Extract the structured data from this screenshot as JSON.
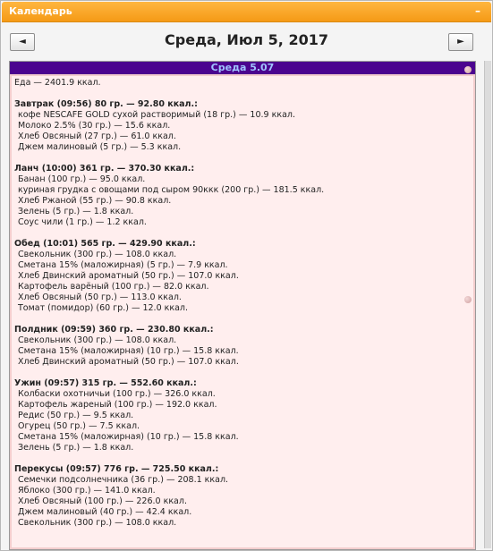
{
  "window": {
    "title": "Календарь",
    "minimize_icon": "minimize-icon"
  },
  "nav": {
    "prev_label": "◄",
    "next_label": "►",
    "date_title": "Среда, Июл 5, 2017"
  },
  "day": {
    "header": "Среда 5.07",
    "total": "Еда — 2401.9 ккал.",
    "meals": [
      {
        "header": "Завтрак (09:56) 80 гр. — 92.80 ккал.:",
        "items": [
          "кофе NESCAFE GOLD сухой растворимый (18 гр.) — 10.9 ккал.",
          "Молоко 2.5% (30 гр.) — 15.6 ккал.",
          "Хлеб Овсяный (27 гр.) — 61.0 ккал.",
          "Джем малиновый (5 гр.) — 5.3 ккал."
        ]
      },
      {
        "header": "Ланч (10:00) 361 гр. — 370.30 ккал.:",
        "items": [
          "Банан (100 гр.) — 95.0 ккал.",
          "куриная грудка с овощами под сыром 90ккк (200 гр.) — 181.5 ккал.",
          "Хлеб Ржаной (55 гр.) — 90.8 ккал.",
          "Зелень (5 гр.) — 1.8 ккал.",
          "Соус чили (1 гр.) — 1.2 ккал."
        ]
      },
      {
        "header": "Обед (10:01) 565 гр. — 429.90 ккал.:",
        "items": [
          "Свекольник (300 гр.) — 108.0 ккал.",
          "Сметана 15% (маложирная) (5 гр.) — 7.9 ккал.",
          "Хлеб Двинский ароматный (50 гр.) — 107.0 ккал.",
          "Картофель варёный (100 гр.) — 82.0 ккал.",
          "Хлеб Овсяный (50 гр.) — 113.0 ккал.",
          "Томат (помидор) (60 гр.) — 12.0 ккал."
        ]
      },
      {
        "header": "Полдник (09:59) 360 гр. — 230.80 ккал.:",
        "items": [
          "Свекольник (300 гр.) — 108.0 ккал.",
          "Сметана 15% (маложирная) (10 гр.) — 15.8 ккал.",
          "Хлеб Двинский ароматный (50 гр.) — 107.0 ккал."
        ]
      },
      {
        "header": "Ужин (09:57) 315 гр. — 552.60 ккал.:",
        "items": [
          "Колбаски охотничьи (100 гр.) — 326.0 ккал.",
          "Картофель жареный (100 гр.) — 192.0 ккал.",
          "Редис (50 гр.) — 9.5 ккал.",
          "Огурец (50 гр.) — 7.5 ккал.",
          "Сметана 15% (маложирная) (10 гр.) — 15.8 ккал.",
          "Зелень (5 гр.) — 1.8 ккал."
        ]
      },
      {
        "header": "Перекусы (09:57) 776 гр. — 725.50 ккал.:",
        "items": [
          "Семечки подсолнечника (36 гр.) — 208.1 ккал.",
          "Яблоко (300 гр.) — 141.0 ккал.",
          "Хлеб Овсяный (100 гр.) — 226.0 ккал.",
          "Джем малиновый (40 гр.) — 42.4 ккал.",
          "Свекольник (300 гр.) — 108.0 ккал."
        ]
      }
    ]
  },
  "colors": {
    "titlebar": "#f59a16",
    "day_header_bg": "#4b048f",
    "day_header_text": "#9fc4ff",
    "day_bg": "#ffeeee"
  }
}
